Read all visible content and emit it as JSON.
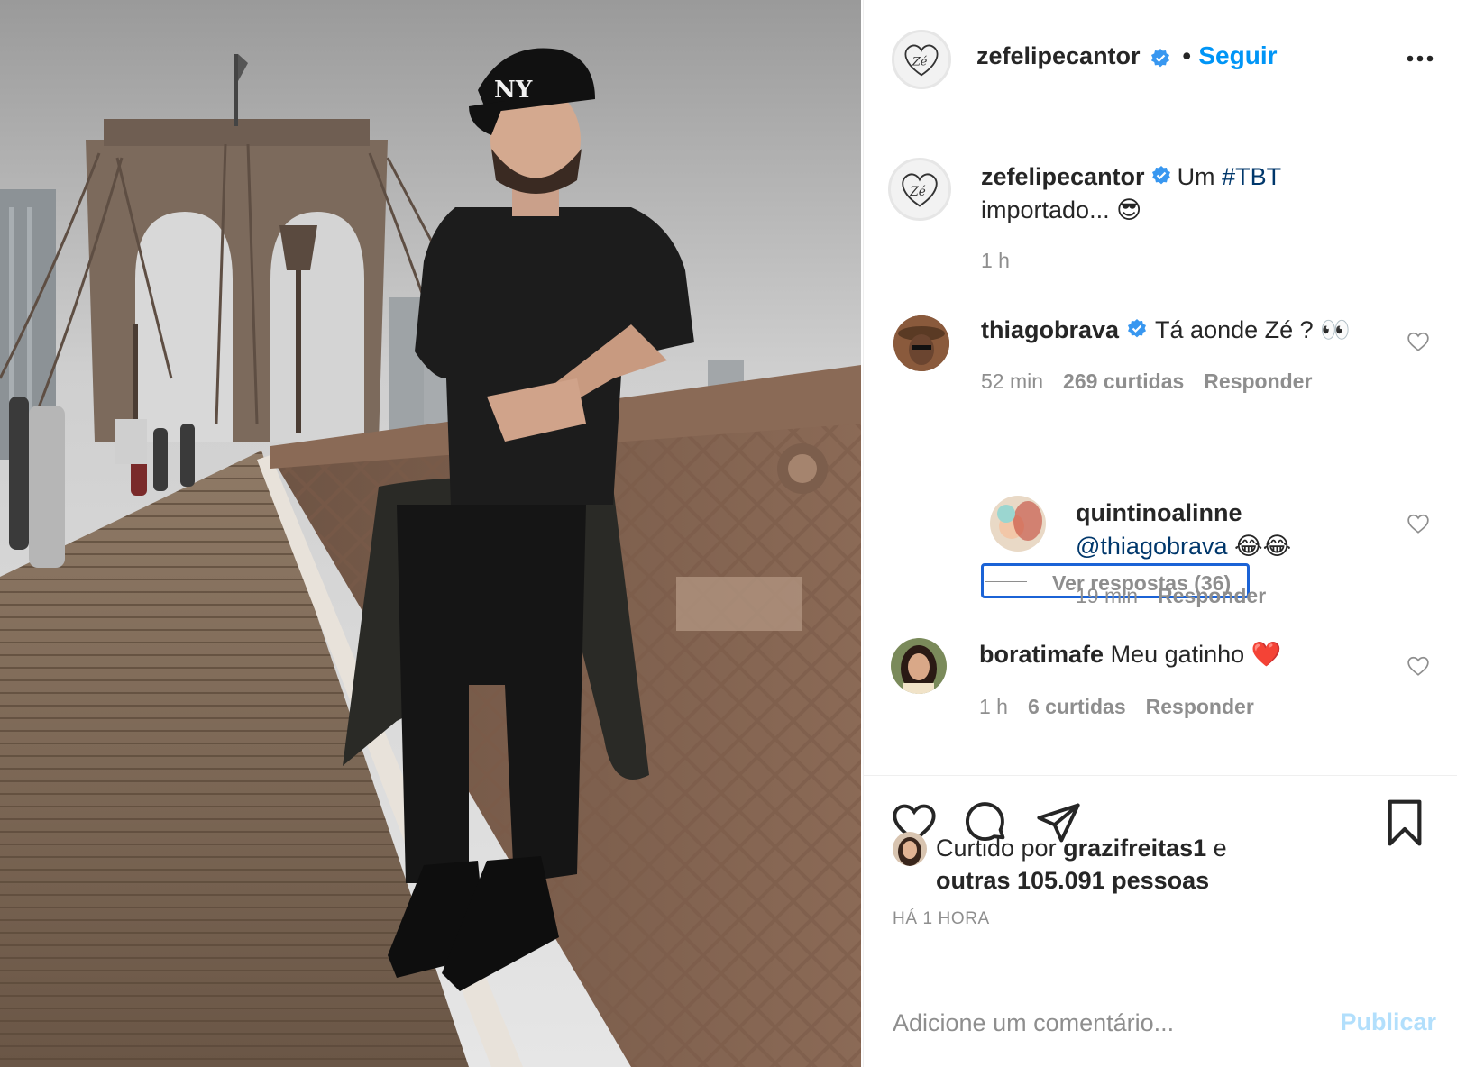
{
  "post": {
    "author": "zefelipecantor",
    "follow_separator": "•",
    "follow_label": "Seguir",
    "avatar_text": "Zé"
  },
  "caption": {
    "username": "zefelipecantor",
    "text_before": "Um ",
    "hashtag": "#TBT",
    "text_after": "importado... 😎",
    "time": "1 h"
  },
  "comments": [
    {
      "username": "thiagobrava",
      "verified": true,
      "text": "Tá aonde Zé ? 👀",
      "time": "52 min",
      "likes": "269 curtidas",
      "reply_label": "Responder",
      "view_replies": "Ver respostas (36)"
    },
    {
      "username": "quintinoalinne",
      "mention": "@thiagobrava",
      "text": "😂😂",
      "time": "19 min",
      "reply_label": "Responder"
    },
    {
      "username": "boratimafe",
      "text": "Meu gatinho ❤️",
      "time": "1 h",
      "likes": "6 curtidas",
      "reply_label": "Responder"
    }
  ],
  "liked_by": {
    "prefix": "Curtido por ",
    "user": "grazifreitas1",
    "middle": " e",
    "others": "outras 105.091 pessoas"
  },
  "timestamp": "HÁ 1 HORA",
  "composer": {
    "placeholder": "Adicione um comentário...",
    "publish_label": "Publicar"
  },
  "colors": {
    "link": "#0095f6",
    "verified": "#3897f0",
    "secondary_text": "#8e8e8e",
    "focus_outline": "#1b63d6"
  },
  "icons": [
    "verified-badge-icon",
    "more-options-icon",
    "heart-icon",
    "comment-icon",
    "share-icon",
    "bookmark-icon"
  ]
}
